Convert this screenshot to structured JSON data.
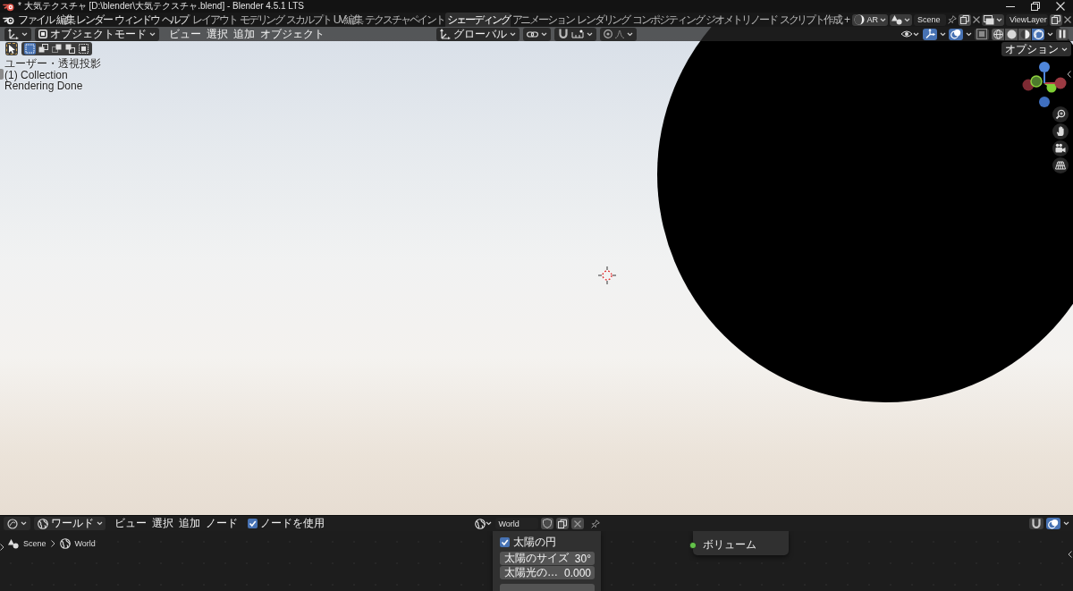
{
  "window": {
    "title": "* 大気テクスチャ [D:\\blender\\大気テクスチャ.blend] - Blender 4.5.1 LTS"
  },
  "menu": [
    "ファイル",
    "編集",
    "レンダー",
    "ウィンドウ",
    "ヘルプ"
  ],
  "workspaces": [
    {
      "label": "レイアウト",
      "selected": false
    },
    {
      "label": "モデリング",
      "selected": false
    },
    {
      "label": "スカルプト",
      "selected": false
    },
    {
      "label": "UV編集",
      "selected": false
    },
    {
      "label": "テクスチャペイント",
      "selected": false
    },
    {
      "label": "シェーディング",
      "selected": true
    },
    {
      "label": "アニメーション",
      "selected": false
    },
    {
      "label": "レンダリング",
      "selected": false
    },
    {
      "label": "コンポジティング",
      "selected": false
    },
    {
      "label": "ジオメトリノード",
      "selected": false
    },
    {
      "label": "スクリプト作成",
      "selected": false
    }
  ],
  "add_workspace": "+",
  "topbar_right": {
    "addon_label": "AR",
    "scene": "Scene",
    "view_layer": "ViewLayer"
  },
  "viewport": {
    "header": {
      "mode": "オブジェクトモード",
      "menus": [
        "ビュー",
        "選択",
        "追加",
        "オブジェクト"
      ],
      "orientation": "グローバル",
      "toggles": [
        {
          "kind": "gizmo",
          "on": true
        },
        {
          "kind": "overlay",
          "on": true
        },
        {
          "kind": "xray",
          "on": false
        }
      ],
      "shading": [
        {
          "kind": "wireframe",
          "selected": false
        },
        {
          "kind": "solid",
          "selected": false
        },
        {
          "kind": "material",
          "selected": false
        },
        {
          "kind": "rendered",
          "selected": true
        }
      ]
    },
    "select_modes": [
      {
        "kind": "set",
        "selected": true
      },
      {
        "kind": "extend",
        "selected": false
      },
      {
        "kind": "subtract",
        "selected": false
      },
      {
        "kind": "invert",
        "selected": false
      },
      {
        "kind": "intersect",
        "selected": false
      }
    ],
    "options": "オプション",
    "overlay_text": [
      "ユーザー・透視投影",
      "(1) Collection",
      "Rendering Done"
    ]
  },
  "node_editor": {
    "header": {
      "shader_type": "ワールド",
      "menus": [
        "ビュー",
        "選択",
        "追加",
        "ノード"
      ],
      "use_nodes": {
        "label": "ノードを使用",
        "checked": true
      },
      "world": "World",
      "toggles": [
        {
          "kind": "snap",
          "on": false
        },
        {
          "kind": "overlay",
          "on": true
        }
      ]
    },
    "breadcrumb": [
      {
        "kind": "scene",
        "label": "Scene"
      },
      {
        "kind": "world",
        "label": "World"
      }
    ],
    "sky_node": {
      "sun_disc": {
        "label": "太陽の円",
        "checked": true
      },
      "fields": [
        {
          "label": "太陽のサイズ",
          "value": "30°"
        },
        {
          "label": "太陽光の…",
          "value": "0.000"
        }
      ]
    },
    "background_node": {
      "outputs": [
        "ボリューム"
      ]
    }
  }
}
